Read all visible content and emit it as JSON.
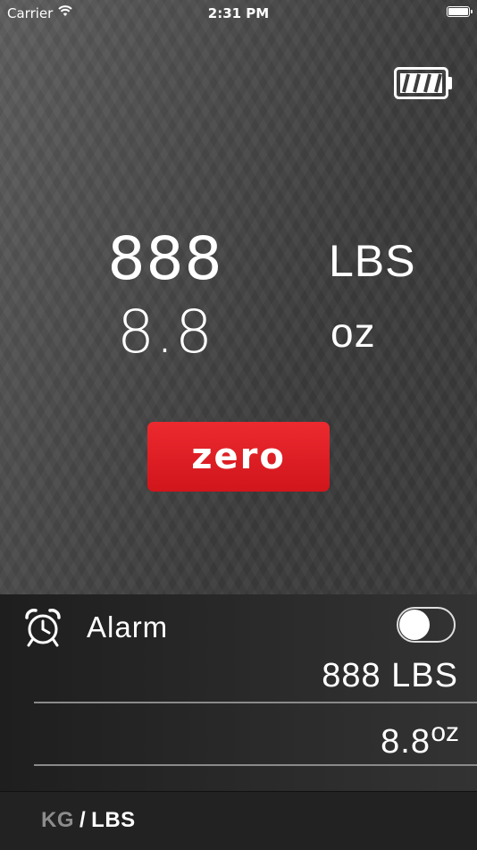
{
  "status_bar": {
    "carrier": "Carrier",
    "time": "2:31 PM"
  },
  "device": {
    "battery_icon": "battery-icon"
  },
  "readings": {
    "main_value": "888",
    "main_unit": "LBS",
    "sub_value": "8.8",
    "sub_unit": "oz"
  },
  "zero_button": {
    "label": "zero",
    "color": "#e01e24"
  },
  "alarm": {
    "icon": "alarm-clock-icon",
    "label": "Alarm",
    "enabled": false,
    "value_main": "888 LBS",
    "value_sub": "8.8",
    "value_sub_unit": "oz"
  },
  "units": {
    "kg_label": "KG",
    "separator": "/",
    "lbs_label": "LBS",
    "selected": "LBS"
  }
}
